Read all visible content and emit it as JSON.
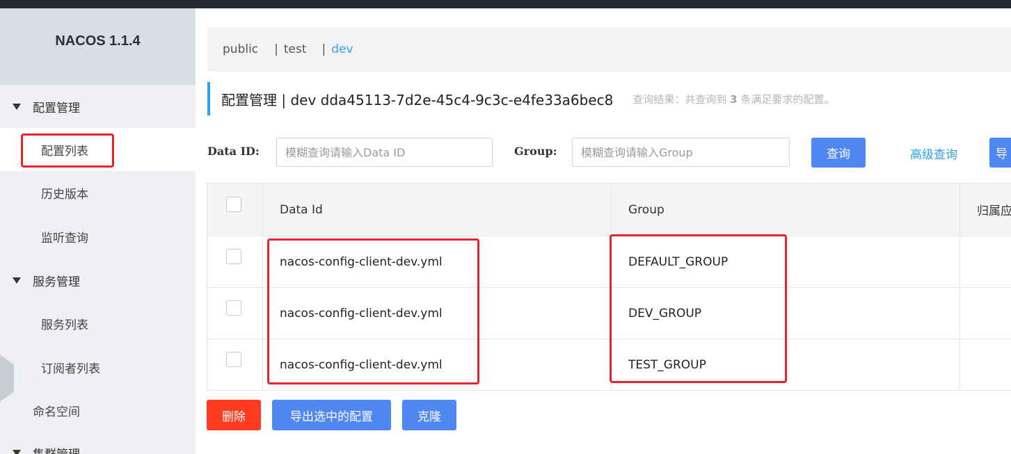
{
  "app": {
    "title": "NACOS 1.1.4"
  },
  "sidebar": {
    "groups": [
      {
        "label": "配置管理",
        "items": [
          "配置列表",
          "历史版本",
          "监听查询"
        ]
      },
      {
        "label": "服务管理",
        "items": [
          "服务列表",
          "订阅者列表"
        ]
      }
    ],
    "namespace_label": "命名空间",
    "cluster_label": "集群管理"
  },
  "namespaces": [
    "public",
    "test",
    "dev"
  ],
  "namespace_sep": "|",
  "header": {
    "title": "配置管理 | dev dda45113-7d2e-45c4-9c3c-e4fe33a6bec8",
    "hint_prefix": "查询结果：共查询到",
    "hint_count": "3",
    "hint_suffix": "条满足要求的配置。"
  },
  "filter": {
    "dataid_label": "Data ID:",
    "dataid_placeholder": "模糊查询请输入Data ID",
    "group_label": "Group:",
    "group_placeholder": "模糊查询请输入Group",
    "query_button": "查询",
    "advanced_link": "高级查询",
    "export_button_partial": "导"
  },
  "table": {
    "columns": [
      "Data Id",
      "Group",
      "归属应"
    ],
    "rows": [
      {
        "data_id": "nacos-config-client-dev.yml",
        "group": "DEFAULT_GROUP"
      },
      {
        "data_id": "nacos-config-client-dev.yml",
        "group": "DEV_GROUP"
      },
      {
        "data_id": "nacos-config-client-dev.yml",
        "group": "TEST_GROUP"
      }
    ]
  },
  "actions": {
    "delete": "删除",
    "export_selected": "导出选中的配置",
    "clone": "克隆"
  },
  "colors": {
    "accent_blue": "#5087f0",
    "link_blue": "#2fa1e8",
    "danger_red": "#ff3b1f",
    "highlight_red": "#e8232a"
  }
}
